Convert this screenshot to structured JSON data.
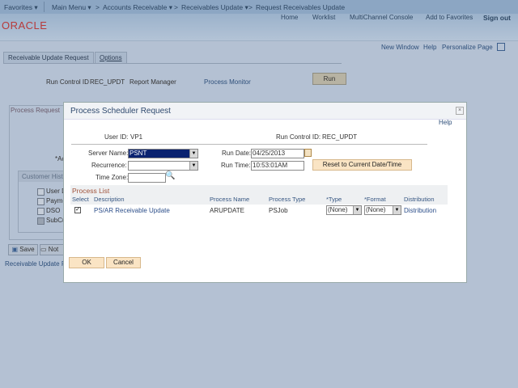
{
  "topnav": {
    "favorites": "Favorites",
    "main_menu": "Main Menu",
    "sep": ">",
    "accounts_receivable": "Accounts Receivable",
    "receivables_update": "Receivables Update",
    "current": "Request Receivables Update"
  },
  "header_links": [
    "Home",
    "Worklist",
    "MultiChannel Console",
    "Add to Favorites",
    "Sign out"
  ],
  "logo": "ORACLE",
  "page_links": [
    "New Window",
    "Help",
    "Personalize Page"
  ],
  "tabs": [
    "Receivable Update Request",
    "Options"
  ],
  "run_control": {
    "label": "Run Control ID",
    "value": "REC_UPDT",
    "report_manager": "Report Manager",
    "process_monitor": "Process Monitor",
    "run": "Run"
  },
  "process_request": {
    "title": "Process Request",
    "as_of_label": "*Ac",
    "customer_history": "Customer Hist",
    "checkboxes": [
      "User D",
      "Payme",
      "DSO",
      "SubCu"
    ]
  },
  "footer": {
    "save": "Save",
    "notify": "Not",
    "link": "Receivable Update R"
  },
  "modal": {
    "title": "Process Scheduler Request",
    "help": "Help",
    "user_id_label": "User ID:",
    "user_id": "VP1",
    "run_control_label": "Run Control ID:",
    "run_control": "REC_UPDT",
    "server_name_label": "Server Name:",
    "server_name": "PSNT",
    "recurrence_label": "Recurrence:",
    "recurrence": "",
    "time_zone_label": "Time Zone:",
    "time_zone": "",
    "run_date_label": "Run Date:",
    "run_date": "04/25/2013",
    "run_time_label": "Run Time:",
    "run_time": "10:53:01AM",
    "reset_button": "Reset to Current Date/Time",
    "process_list_title": "Process List",
    "columns": [
      "Select",
      "Description",
      "Process Name",
      "Process Type",
      "*Type",
      "*Format",
      "Distribution"
    ],
    "rows": [
      {
        "selected": true,
        "description": "PS/AR Receivable Update",
        "process_name": "ARUPDATE",
        "process_type": "PSJob",
        "type": "(None)",
        "format": "(None)",
        "distribution": "Distribution"
      }
    ],
    "ok": "OK",
    "cancel": "Cancel"
  }
}
